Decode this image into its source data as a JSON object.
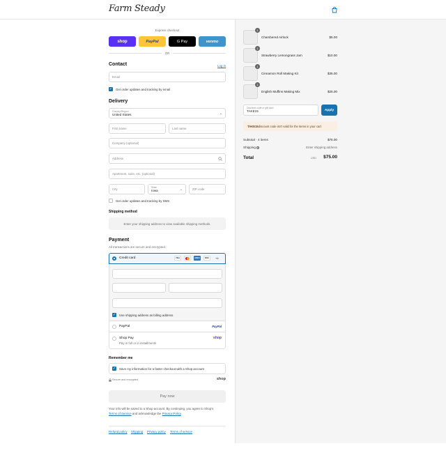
{
  "header": {
    "logo": "Farm Steady",
    "cart_icon": "shopping-bag-icon"
  },
  "express": {
    "label": "Express checkout",
    "buttons": [
      {
        "label": "shop",
        "color": "#5a31f4"
      },
      {
        "label": "PayPal",
        "color": "#ffc439"
      },
      {
        "label": "G Pay",
        "color": "#000000"
      },
      {
        "label": "venmo",
        "color": "#3d95ce"
      }
    ],
    "or": "OR"
  },
  "contact": {
    "title": "Contact",
    "login_link": "Log in",
    "email_placeholder": "Email",
    "updates_label": "Get order updates and tracking by email"
  },
  "delivery": {
    "title": "Delivery",
    "country_label": "Country/Region",
    "country_value": "United States",
    "first_name": "First name",
    "last_name": "Last name",
    "company": "Company (optional)",
    "address": "Address",
    "apartment": "Apartment, suite, etc. (optional)",
    "city": "City",
    "state_label": "State",
    "state_value": "Iowa",
    "zip": "ZIP code",
    "sms_label": "Get order updates and tracking by SMS"
  },
  "shipping_method": {
    "title": "Shipping method",
    "message": "Enter your shipping address to view available shipping methods."
  },
  "payment": {
    "title": "Payment",
    "subtitle": "All transactions are secure and encrypted.",
    "credit_card_label": "Credit card",
    "card_brands": [
      "VISA",
      "MC",
      "AMEX",
      "DISC"
    ],
    "more_brands": "+4",
    "billing_label": "Use shipping address as billing address",
    "paypal_label": "PayPal",
    "paypal_logo": "PayPal",
    "shoppay_label": "Shop Pay",
    "shoppay_sub": "Pay in full or in installments",
    "shoppay_logo": "shop"
  },
  "remember": {
    "title": "Remember me",
    "save_label": "Save my information for a faster checkout with a Shop account",
    "secure": "Secure and encrypted",
    "shop_logo": "shop"
  },
  "pay_now": "Pay now",
  "legal": {
    "line1": "Your info will be saved to a Shop account. By continuing, you agree to Shop's",
    "terms": "Terms of Service",
    "and": " and acknowledge the ",
    "privacy": "Privacy Policy",
    "period": "."
  },
  "footer_links": [
    "Refund policy",
    "Shipping",
    "Privacy policy",
    "Terms of service"
  ],
  "cart": {
    "items": [
      {
        "name": "Chambered Airlock",
        "qty": "1",
        "price": "$5.00"
      },
      {
        "name": "Strawberry Lemongrass Jam",
        "qty": "1",
        "price": "$10.00"
      },
      {
        "name": "Cinnamon Roll Making Kit",
        "qty": "1",
        "price": "$35.00"
      },
      {
        "name": "English Muffins Making Mix",
        "qty": "1",
        "price": "$25.00"
      }
    ],
    "discount_label": "Discount code or gift card",
    "discount_value": "TAKE15",
    "apply": "Apply",
    "error_code": "TAKE15",
    "error_msg": " discount code isn't valid for the items in your cart",
    "subtotal_label": "Subtotal · 4 items",
    "subtotal_value": "$75.00",
    "shipping_label": "Shipping",
    "shipping_value": "Enter shipping address",
    "total_label": "Total",
    "currency": "USD",
    "total_value": "$75.00"
  }
}
